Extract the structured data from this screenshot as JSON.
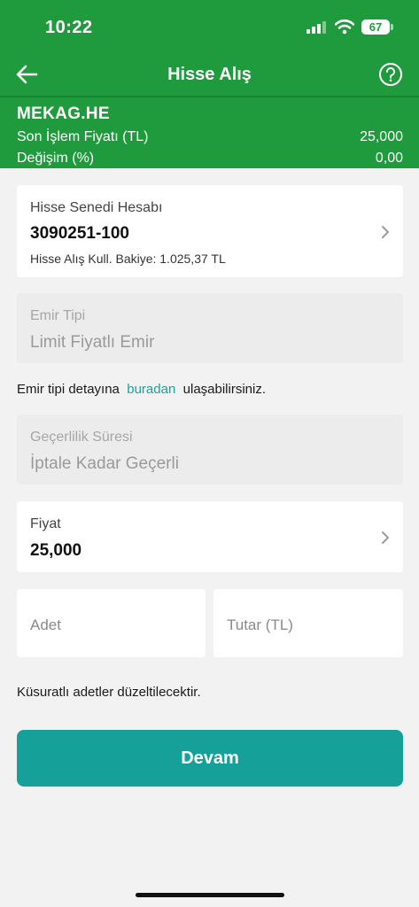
{
  "status": {
    "time": "10:22",
    "battery": "67"
  },
  "nav": {
    "title": "Hisse Alış"
  },
  "stock": {
    "symbol": "MEKAG.HE",
    "last_price_label": "Son İşlem Fiyatı (TL)",
    "last_price_value": "25,000",
    "change_label": "Değişim (%)",
    "change_value": "0,00"
  },
  "account": {
    "label": "Hisse Senedi Hesabı",
    "number": "3090251-100",
    "balance": "Hisse Alış Kull. Bakiye: 1.025,37 TL"
  },
  "order_type": {
    "label": "Emir Tipi",
    "value": "Limit Fiyatlı Emir"
  },
  "order_info": {
    "before": "Emir tipi detayına",
    "link": "buradan",
    "after": "ulaşabilirsiniz."
  },
  "validity": {
    "label": "Geçerlilik Süresi",
    "value": "İptale Kadar Geçerli"
  },
  "price": {
    "label": "Fiyat",
    "value": "25,000"
  },
  "quantity": {
    "placeholder": "Adet"
  },
  "amount": {
    "placeholder": "Tutar (TL)"
  },
  "note": "Küsuratlı adetler düzeltilecektir.",
  "continue_label": "Devam",
  "colors": {
    "header": "#1f9a3c",
    "accent": "#15a09a",
    "link": "#1aa39a"
  }
}
